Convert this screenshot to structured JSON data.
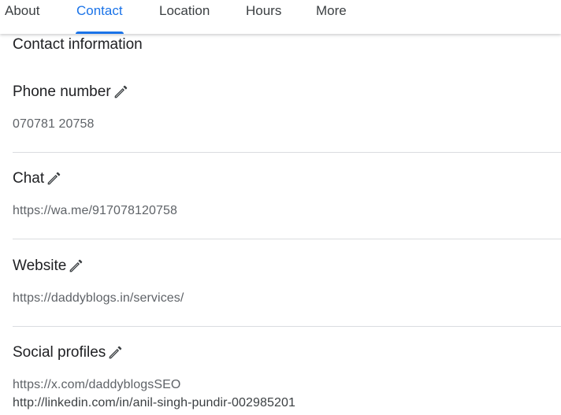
{
  "tabs": {
    "about": "About",
    "contact": "Contact",
    "location": "Location",
    "hours": "Hours",
    "more": "More",
    "active": "Contact",
    "accent_color": "#1a73e8"
  },
  "contact": {
    "heading": "Contact information",
    "phone": {
      "label": "Phone number",
      "value": "070781 20758",
      "icon": "pencil-edit-icon"
    },
    "chat": {
      "label": "Chat",
      "value": "https://wa.me/917078120758",
      "icon": "pencil-edit-icon"
    },
    "website": {
      "label": "Website",
      "value": "https://daddyblogs.in/services/",
      "icon": "pencil-edit-icon"
    },
    "social": {
      "label": "Social profiles",
      "icon": "pencil-edit-icon",
      "values": [
        "https://x.com/daddyblogsSEO",
        "http://linkedin.com/in/anil-singh-pundir-002985201"
      ]
    }
  }
}
